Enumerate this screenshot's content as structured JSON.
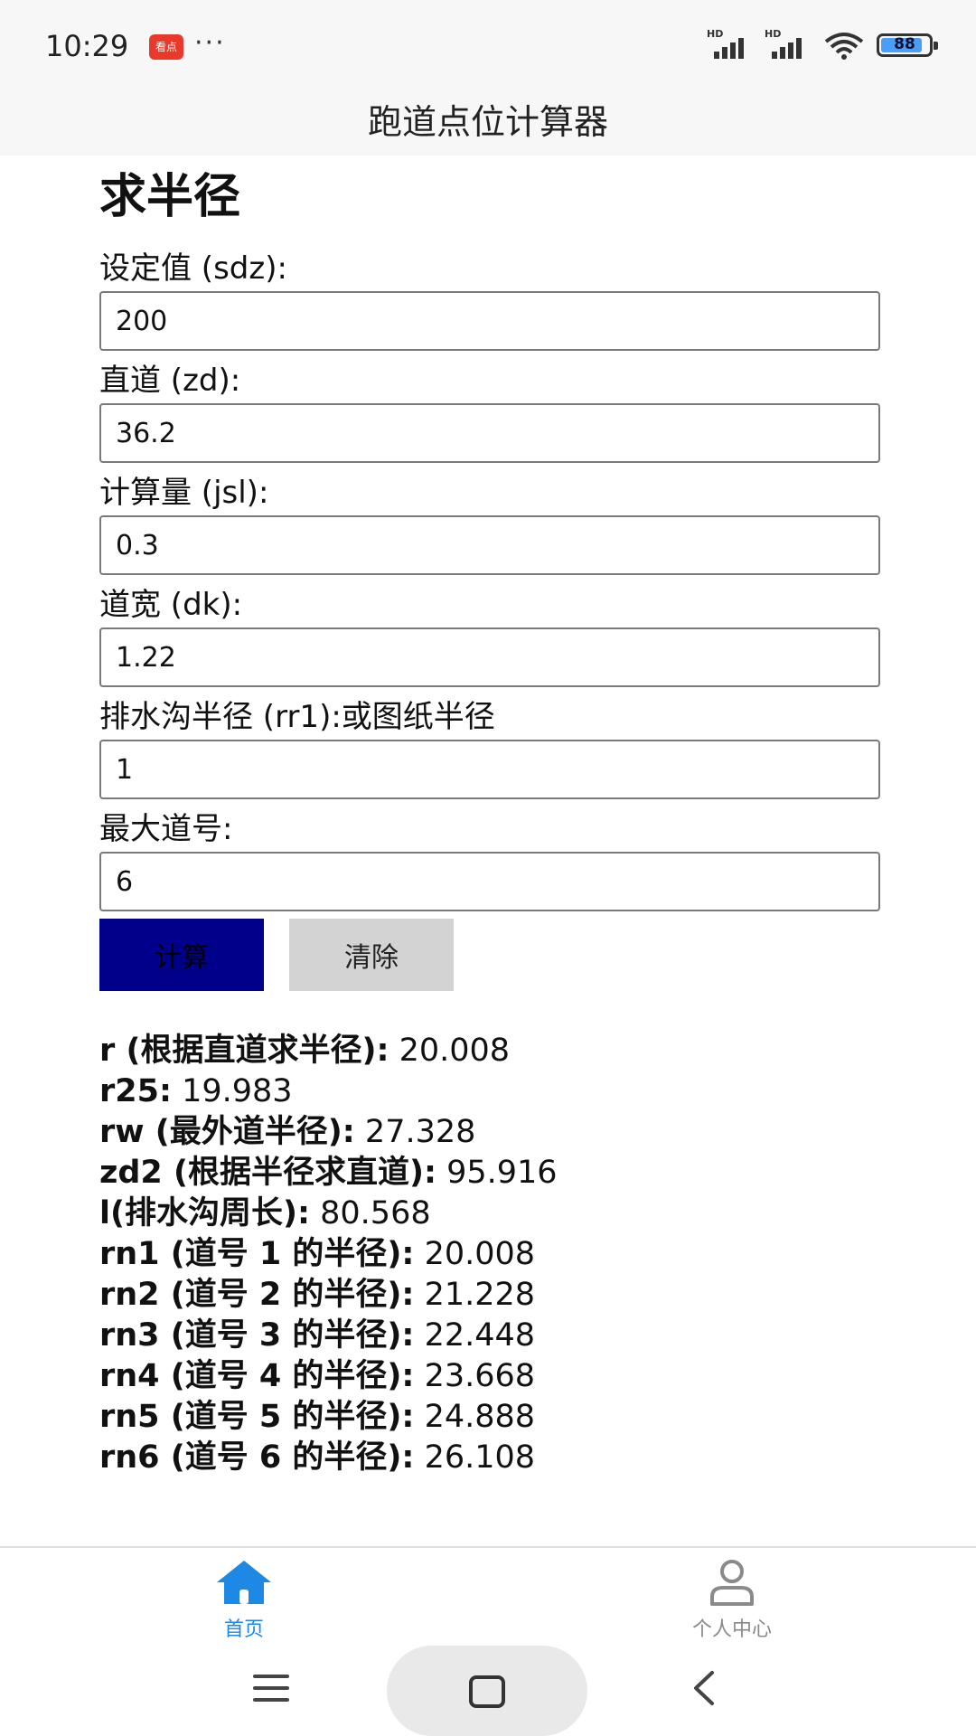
{
  "status": {
    "time": "10:29",
    "notification_app": "看点",
    "more": "···",
    "signal1_label": "HD",
    "signal2_label": "HD",
    "battery_level": "88",
    "battery_fraction": 0.88
  },
  "header": {
    "title": "跑道点位计算器"
  },
  "form": {
    "title": "求半径",
    "fields": [
      {
        "label": "设定值 (sdz):",
        "value": "200"
      },
      {
        "label": "直道 (zd):",
        "value": "36.2"
      },
      {
        "label": "计算量 (jsl):",
        "value": "0.3"
      },
      {
        "label": "道宽 (dk):",
        "value": "1.22"
      },
      {
        "label": "排水沟半径 (rr1):或图纸半径",
        "value": "1"
      },
      {
        "label": "最大道号:",
        "value": "6"
      }
    ],
    "calc_label": "计算",
    "clear_label": "清除"
  },
  "results": [
    {
      "label": "r (根据直道求半径):",
      "value": "20.008"
    },
    {
      "label": "r25:",
      "value": "19.983"
    },
    {
      "label": "rw (最外道半径):",
      "value": "27.328"
    },
    {
      "label": "zd2 (根据半径求直道):",
      "value": "95.916"
    },
    {
      "label": "l(排水沟周长):",
      "value": "80.568"
    },
    {
      "label": "rn1 (道号 1 的半径):",
      "value": "20.008"
    },
    {
      "label": "rn2 (道号 2 的半径):",
      "value": "21.228"
    },
    {
      "label": "rn3 (道号 3 的半径):",
      "value": "22.448"
    },
    {
      "label": "rn4 (道号 4 的半径):",
      "value": "23.668"
    },
    {
      "label": "rn5 (道号 5 的半径):",
      "value": "24.888"
    },
    {
      "label": "rn6 (道号 6 的半径):",
      "value": "26.108"
    }
  ],
  "tabbar": {
    "home_label": "首页",
    "profile_label": "个人中心",
    "active_color": "#1e88e5",
    "inactive_color": "#8a8a8a"
  },
  "icons": {
    "tab_home": "home-icon",
    "tab_profile": "person-icon",
    "nav_menu": "menu-icon",
    "nav_home": "square-icon",
    "nav_back": "back-chevron-icon"
  }
}
